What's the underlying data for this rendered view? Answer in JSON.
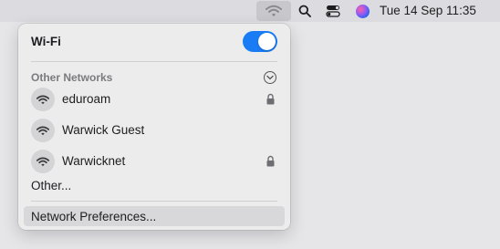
{
  "menubar": {
    "icons": [
      "wifi-icon",
      "search-icon",
      "control-center-icon",
      "siri-icon"
    ],
    "clock": "Tue 14 Sep  11:35"
  },
  "wifi_menu": {
    "title": "Wi-Fi",
    "toggle_on": true,
    "section_header": "Other Networks",
    "networks": [
      {
        "name": "eduroam",
        "locked": true
      },
      {
        "name": "Warwick Guest",
        "locked": false
      },
      {
        "name": "Warwicknet",
        "locked": true
      }
    ],
    "other_label": "Other...",
    "preferences_label": "Network Preferences..."
  },
  "colors": {
    "toggle_on": "#1a7cf5",
    "panel_bg": "#ececed",
    "highlight": "#d8d8da"
  }
}
